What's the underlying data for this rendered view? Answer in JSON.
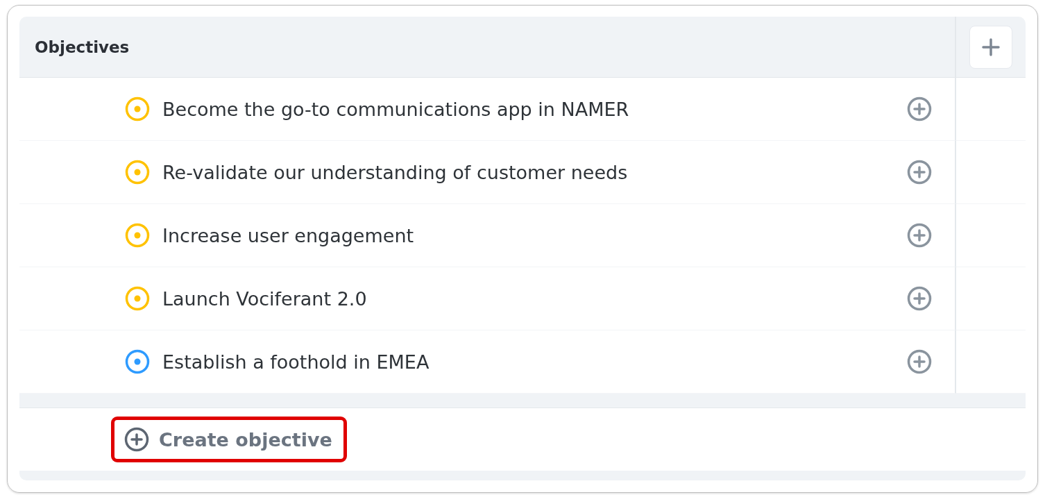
{
  "panel": {
    "title": "Objectives"
  },
  "objectives": [
    {
      "title": "Become the go-to communications app in NAMER",
      "color": "#ffc200"
    },
    {
      "title": "Re-validate our understanding of customer needs",
      "color": "#ffc200"
    },
    {
      "title": "Increase user engagement",
      "color": "#ffc200"
    },
    {
      "title": "Launch Vociferant 2.0",
      "color": "#ffc200"
    },
    {
      "title": "Establish a foothold in EMEA",
      "color": "#2e9bff"
    }
  ],
  "create_button": {
    "label": "Create objective",
    "highlighted": true
  }
}
